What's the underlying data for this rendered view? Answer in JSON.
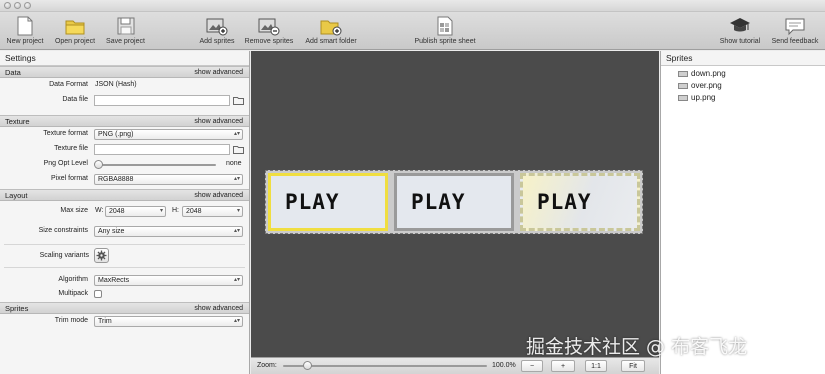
{
  "toolbar": {
    "new_project": "New project",
    "open_project": "Open project",
    "save_project": "Save project",
    "add_sprites": "Add sprites",
    "remove_sprites": "Remove sprites",
    "add_smart_folder": "Add smart folder",
    "publish_sprite_sheet": "Publish sprite sheet",
    "show_tutorial": "Show tutorial",
    "send_feedback": "Send feedback"
  },
  "settings": {
    "title": "Settings",
    "show_advanced": "show advanced",
    "data": {
      "header": "Data",
      "format_label": "Data Format",
      "format_value": "JSON (Hash)",
      "file_label": "Data file",
      "file_value": ""
    },
    "texture": {
      "header": "Texture",
      "format_label": "Texture format",
      "format_value": "PNG (.png)",
      "file_label": "Texture file",
      "file_value": "",
      "png_opt_label": "Png Opt Level",
      "png_opt_value": "none",
      "png_opt_level": 0,
      "pixel_format_label": "Pixel format",
      "pixel_format_value": "RGBA8888"
    },
    "layout": {
      "header": "Layout",
      "max_size_label": "Max size",
      "w_label": "W:",
      "w_value": "2048",
      "h_label": "H:",
      "h_value": "2048",
      "size_constraints_label": "Size constraints",
      "size_constraints_value": "Any size",
      "scaling_variants_label": "Scaling variants",
      "algorithm_label": "Algorithm",
      "algorithm_value": "MaxRects",
      "multipack_label": "Multipack",
      "multipack_checked": false
    },
    "sprites": {
      "header": "Sprites",
      "trim_mode_label": "Trim mode",
      "trim_mode_value": "Trim"
    }
  },
  "canvas": {
    "sprite_text": "PLAY",
    "zoom_label": "Zoom:",
    "zoom_value": "100.0%",
    "zoom_level": 0.1,
    "zoom_out": "−",
    "zoom_in": "+",
    "zoom_actual": "1:1",
    "zoom_fit": "Fit"
  },
  "sprites_panel": {
    "title": "Sprites",
    "items": [
      {
        "label": "down.png"
      },
      {
        "label": "over.png"
      },
      {
        "label": "up.png"
      }
    ]
  },
  "watermark": "掘金技术社区 @ 布客飞龙",
  "colors": {
    "canvas_bg": "#4b4b4b",
    "up_border": "#f0de40",
    "down_border": "#9a9a9a"
  }
}
